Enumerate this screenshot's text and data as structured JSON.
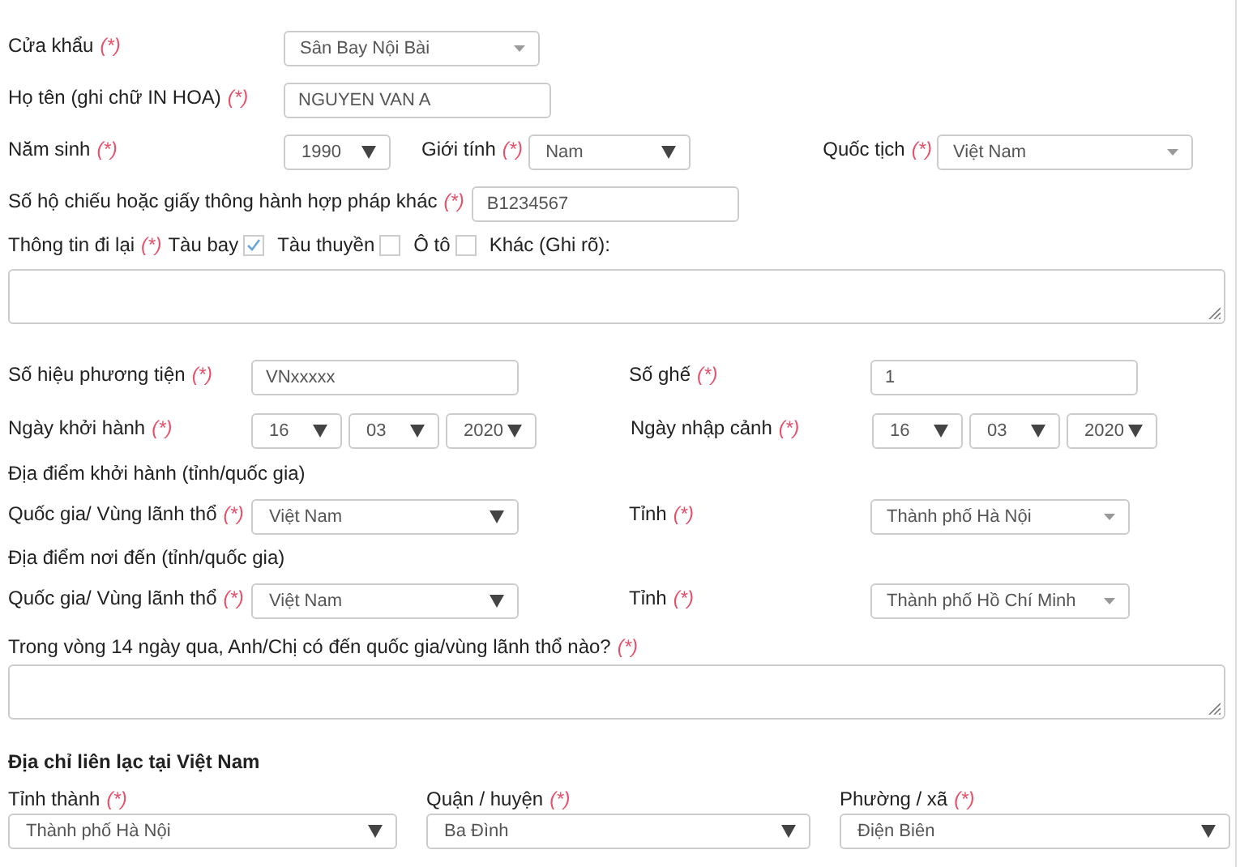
{
  "checkpoint": {
    "label": "Cửa khẩu",
    "required": "(*)",
    "value": "Sân Bay Nội Bài",
    "kind": "select2"
  },
  "full_name": {
    "label": "Họ tên (ghi chữ IN HOA)",
    "required": "(*)",
    "value": "NGUYEN VAN A"
  },
  "birth_year": {
    "label": "Năm sinh",
    "required": "(*)",
    "value": "1990",
    "kind": "native"
  },
  "gender": {
    "label": "Giới tính",
    "required": "(*)",
    "value": "Nam",
    "kind": "native"
  },
  "nationality": {
    "label": "Quốc tịch",
    "required": "(*)",
    "value": "Việt Nam",
    "kind": "select2"
  },
  "passport": {
    "label": "Số hộ chiếu hoặc giấy thông hành hợp pháp khác",
    "required": "(*)",
    "value": "B1234567"
  },
  "travel": {
    "label": "Thông tin đi lại",
    "required": "(*)",
    "options": [
      {
        "label": "Tàu bay",
        "checked": true
      },
      {
        "label": "Tàu thuyền",
        "checked": false
      },
      {
        "label": "Ô tô",
        "checked": false
      }
    ],
    "other_label": "Khác (Ghi rõ):"
  },
  "vehicle_number": {
    "label": "Số hiệu phương tiện",
    "required": "(*)",
    "value": "VNxxxxx"
  },
  "seat": {
    "label": "Số ghế",
    "required": "(*)",
    "value": "1"
  },
  "departure_date": {
    "label": "Ngày khởi hành",
    "required": "(*)",
    "parts": [
      {
        "value": "16",
        "kind": "native"
      },
      {
        "value": "03",
        "kind": "native"
      },
      {
        "value": "2020",
        "kind": "native"
      }
    ]
  },
  "arrival_date": {
    "label": "Ngày nhập cảnh",
    "required": "(*)",
    "parts": [
      {
        "value": "16",
        "kind": "native"
      },
      {
        "value": "03",
        "kind": "native"
      },
      {
        "value": "2020",
        "kind": "native"
      }
    ]
  },
  "departure_place": {
    "heading": "Địa điểm khởi hành (tỉnh/quốc gia)",
    "country": {
      "label": "Quốc gia/ Vùng lãnh thổ",
      "required": "(*)",
      "value": "Việt Nam",
      "kind": "native"
    },
    "province": {
      "label": "Tỉnh",
      "required": "(*)",
      "value": "Thành phố Hà Nội",
      "kind": "select2"
    }
  },
  "destination_place": {
    "heading": "Địa điểm nơi đến (tỉnh/quốc gia)",
    "country": {
      "label": "Quốc gia/ Vùng lãnh thổ",
      "required": "(*)",
      "value": "Việt Nam",
      "kind": "native"
    },
    "province": {
      "label": "Tỉnh",
      "required": "(*)",
      "value": "Thành phố Hồ Chí Minh",
      "kind": "select2"
    }
  },
  "recent_travel": {
    "label": "Trong vòng 14 ngày qua, Anh/Chị có đến quốc gia/vùng lãnh thổ nào?",
    "required": "(*)"
  },
  "contact_address": {
    "heading": "Địa chỉ liên lạc tại Việt Nam",
    "fields": [
      {
        "label": "Tỉnh thành",
        "required": "(*)",
        "value": "Thành phố Hà Nội",
        "kind": "native"
      },
      {
        "label": "Quận / huyện",
        "required": "(*)",
        "value": "Ba Đình",
        "kind": "native"
      },
      {
        "label": "Phường / xã",
        "required": "(*)",
        "value": "Điện Biên",
        "kind": "native"
      }
    ]
  }
}
